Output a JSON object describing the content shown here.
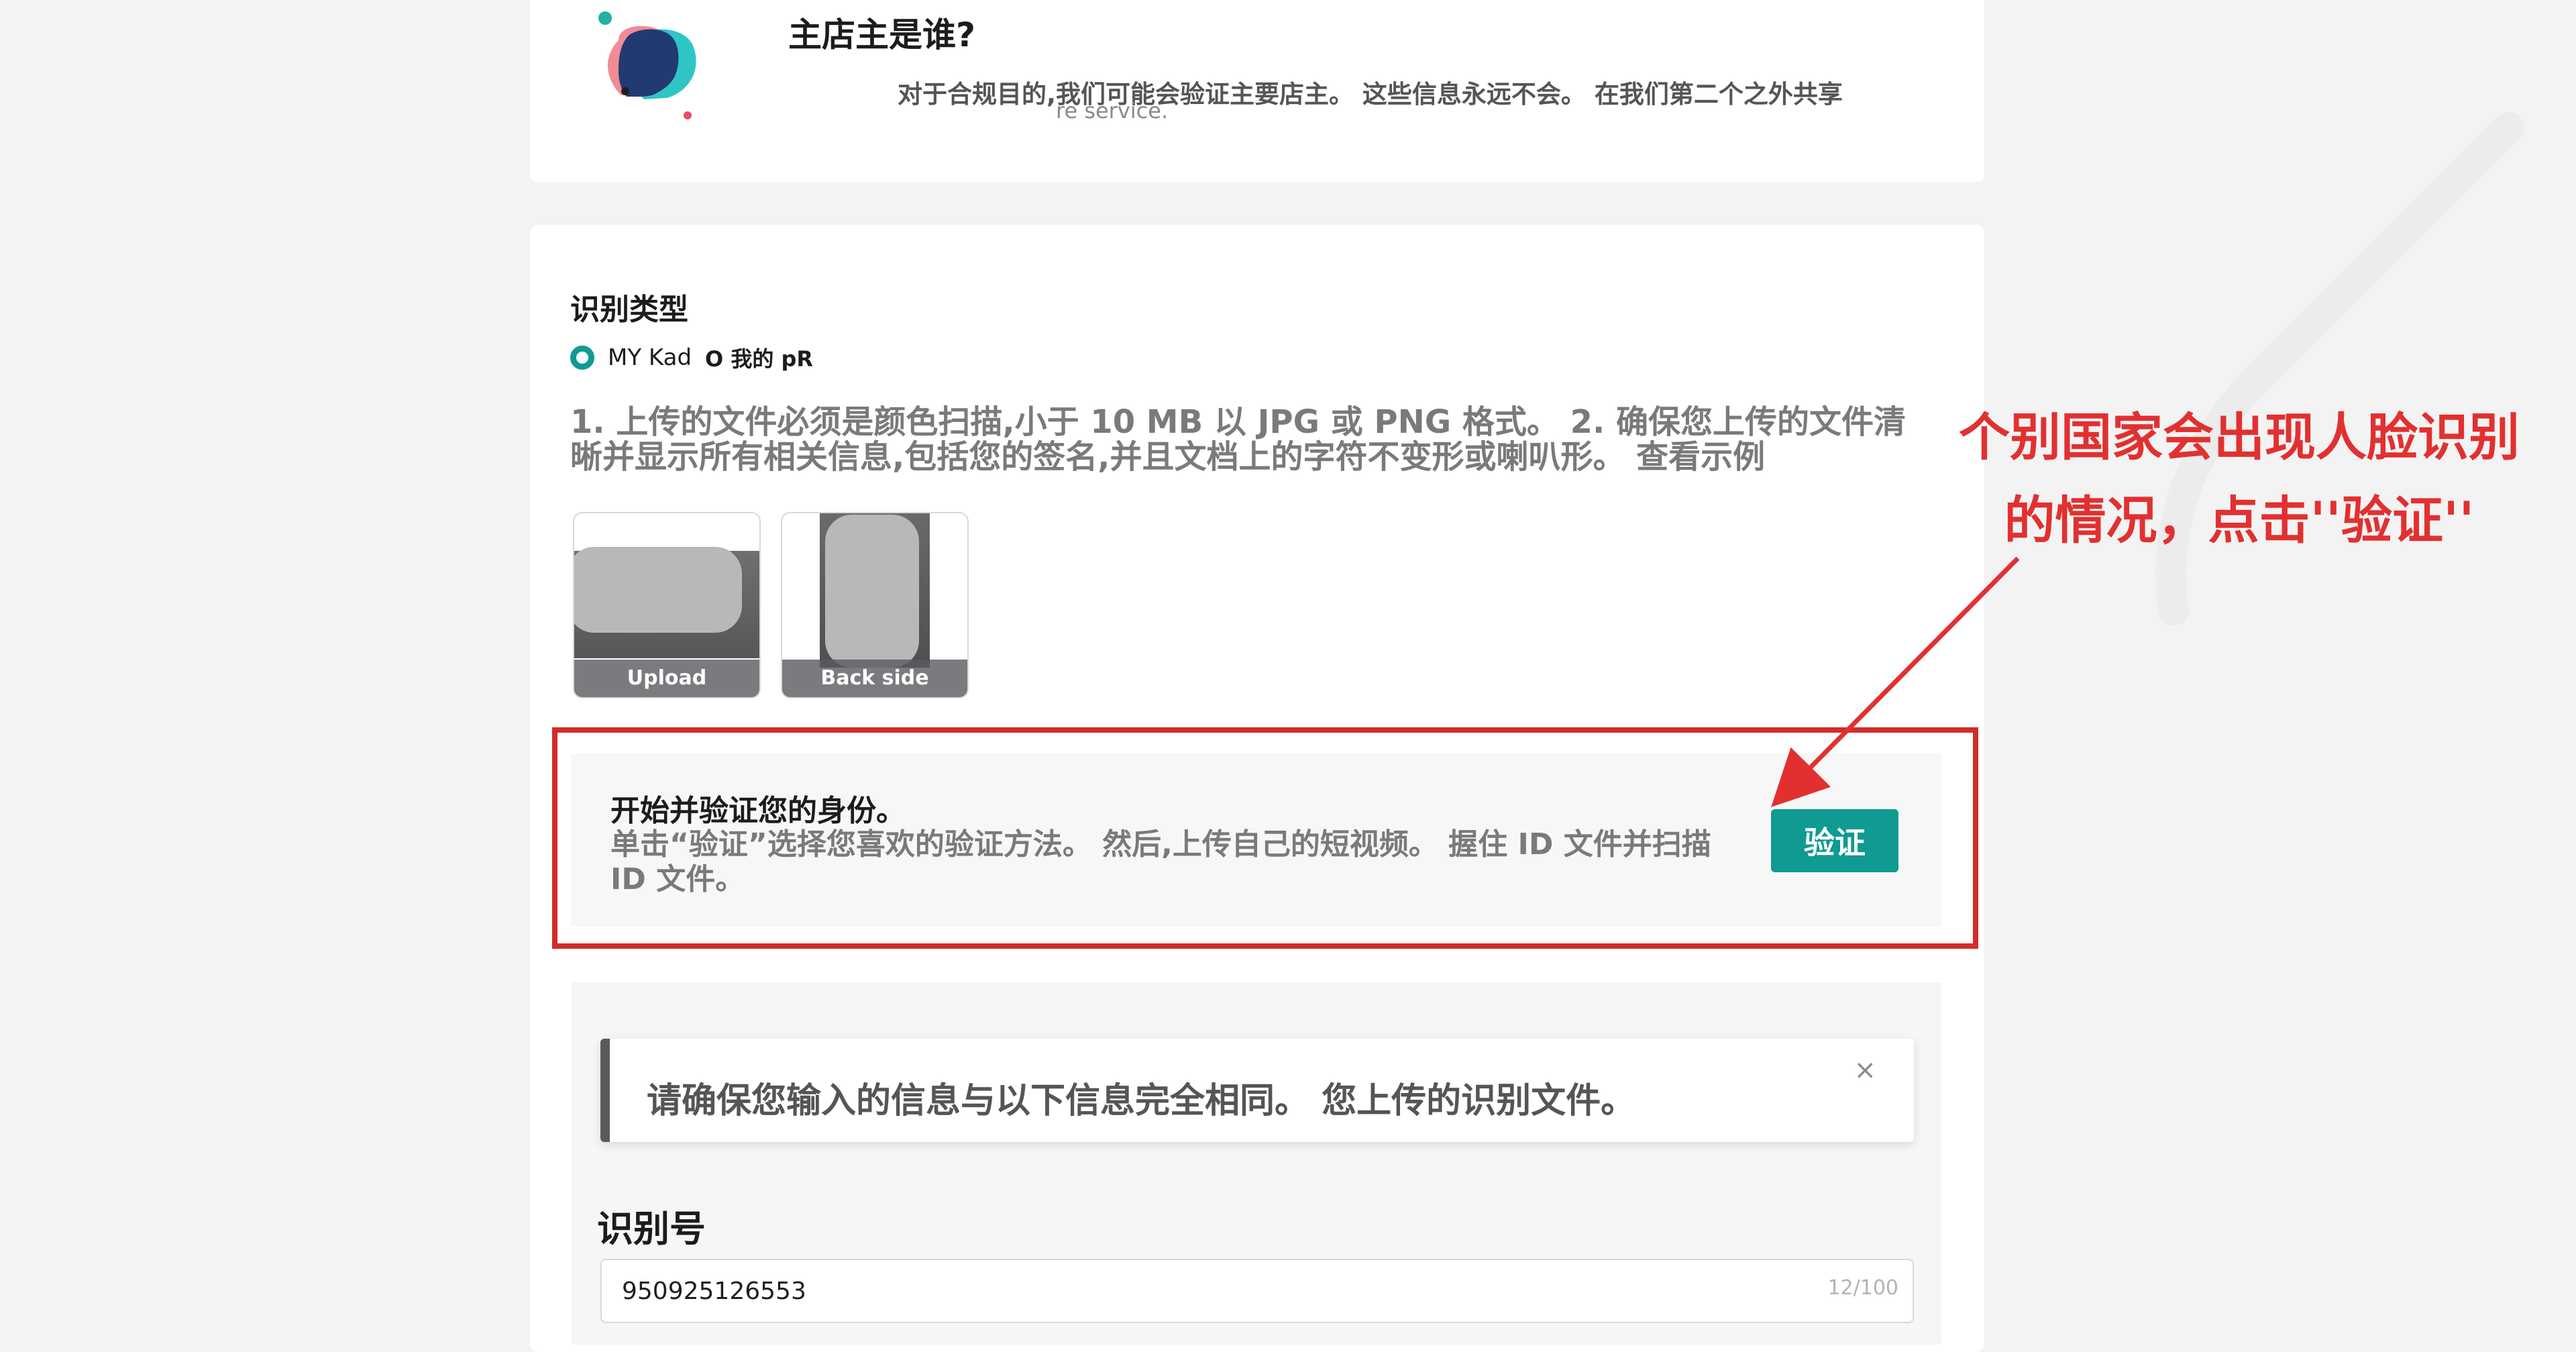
{
  "owner": {
    "title": "主店主是谁?",
    "description": "对于合规目的,我们可能会验证主要店主。 这些信息永远不会。 在我们第二个之外共享",
    "description_tail": "re service."
  },
  "identification": {
    "type_label": "识别类型",
    "selected_option": "MY Kad",
    "other_option": "O 我的 pR",
    "instructions": "1. 上传的文件必须是颜色扫描,小于 10 MB 以 JPG 或 PNG 格式。 2. 确保您上传的文件清晰并显示所有相关信息,包括您的签名,并且文档上的字符不变形或喇叭形。 查看示例",
    "front_caption": "Upload",
    "back_caption": "Back side"
  },
  "verify": {
    "title": "开始并验证您的身份。",
    "description": "单击“验证”选择您喜欢的验证方法。 然后,上传自己的短视频。 握住 ID 文件并扫描 ID 文件。",
    "button_label": "验证"
  },
  "annotation": {
    "line1": "个别国家会出现人脸识别",
    "line2": "的情况，点击''验证''"
  },
  "form": {
    "notice": "请确保您输入的信息与以下信息完全相同。 您上传的识别文件。",
    "close_symbol": "×",
    "id_label": "识别号",
    "id_value": "950925126553",
    "id_counter": "12/100"
  },
  "colors": {
    "accent": "#0f9a92",
    "annotation_red": "#e23030",
    "outline_red": "#d22c2c"
  }
}
